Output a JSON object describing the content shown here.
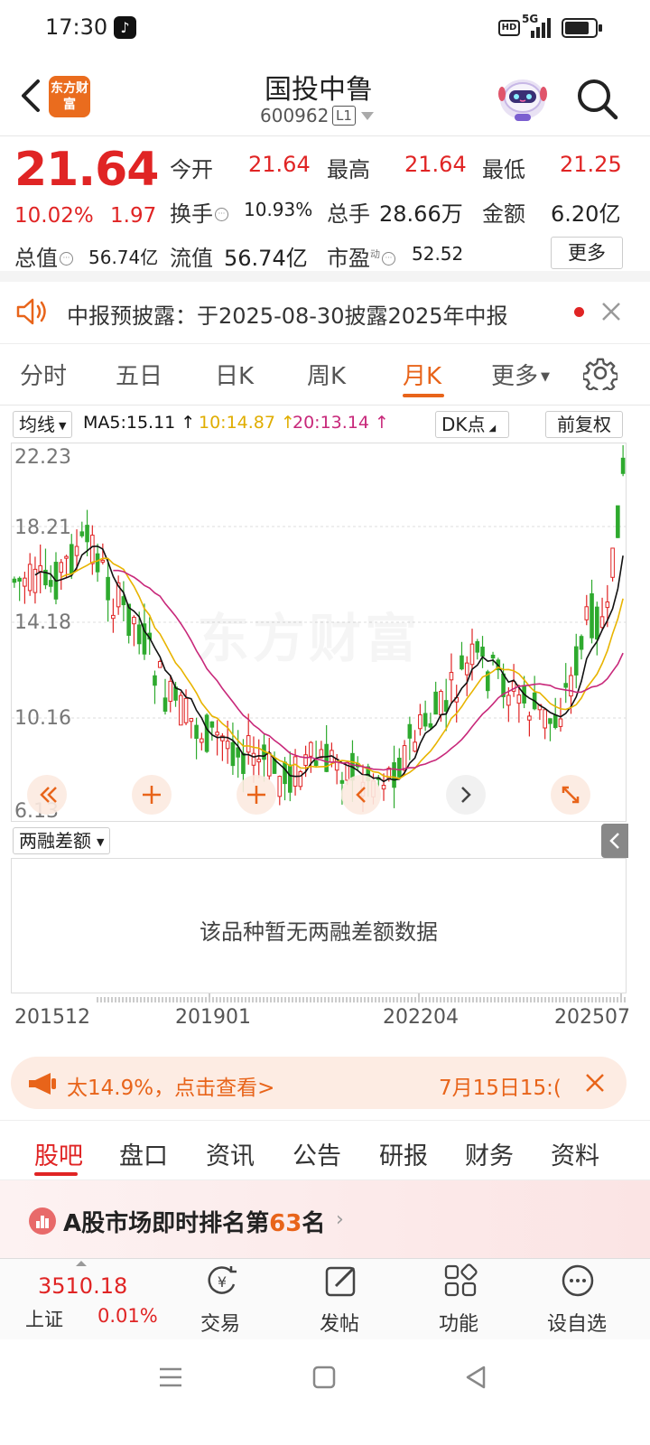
{
  "status_bar": {
    "time": "17:30",
    "hd": "HD",
    "network": "5G"
  },
  "header": {
    "logo_text": "东方财富",
    "stock_name": "国投中鲁",
    "stock_code": "600962",
    "level": "L1"
  },
  "quote": {
    "price": "21.64",
    "change_pct": "10.02%",
    "change_amt": "1.97",
    "open_label": "今开",
    "open": "21.64",
    "high_label": "最高",
    "high": "21.64",
    "low_label": "最低",
    "low": "21.25",
    "turnover_label": "换手",
    "turnover": "10.93%",
    "volume_label": "总手",
    "volume": "28.66万",
    "amount_label": "金额",
    "amount": "6.20亿",
    "mktcap_label": "总值",
    "mktcap": "56.74亿",
    "float_label": "流值",
    "float_cap": "56.74亿",
    "pe_label": "市盈",
    "pe_sup": "动",
    "pe": "52.52",
    "more": "更多"
  },
  "notice": {
    "text": "中报预披露：于2025-08-30披露2025年中报"
  },
  "chart_tabs": [
    "分时",
    "五日",
    "日K",
    "周K",
    "月K",
    "更多"
  ],
  "ma": {
    "selector": "均线",
    "ma5": "MA5:15.11",
    "ma10": "10:14.87",
    "ma20": "20:13.14",
    "arrow": "↑",
    "dk": "DK点",
    "adjust": "前复权"
  },
  "colors": {
    "up": "#e02424",
    "down": "#2eaa2e",
    "ma5": "#111111",
    "ma10": "#e8b400",
    "ma20": "#c8287a",
    "accent": "#e8641a"
  },
  "chart_data": {
    "type": "candlestick",
    "y_ticks": [
      "22.23",
      "18.21",
      "14.18",
      "10.16",
      "6.13"
    ],
    "watermark": "东方财富",
    "x_ticks": [
      "201512",
      "201901",
      "202204",
      "202507"
    ]
  },
  "margin": {
    "selector": "两融差额",
    "empty": "该品种暂无两融差额数据"
  },
  "promo": {
    "text": "太14.9%，点击查看>",
    "date": "7月15日15:("
  },
  "bottom_tabs": [
    "股吧",
    "盘口",
    "资讯",
    "公告",
    "研报",
    "财务",
    "资料"
  ],
  "ranking": {
    "prefix": "A股市场即时排名第",
    "rank": "63",
    "suffix": "名"
  },
  "toolbar": {
    "index_value": "3510.18",
    "index_name": "上证",
    "index_pct": "0.01%",
    "trade": "交易",
    "post": "发帖",
    "functions": "功能",
    "watchlist": "设自选"
  }
}
